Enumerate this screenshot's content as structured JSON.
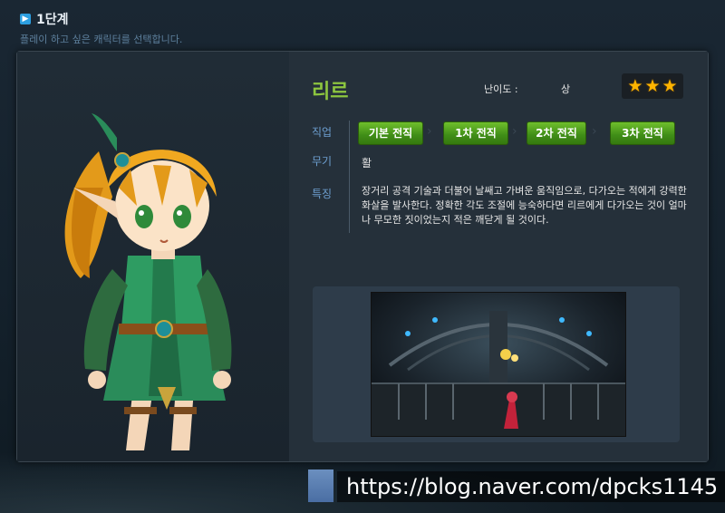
{
  "header": {
    "step_icon": "right-arrow-icon",
    "step_title": "1단계",
    "step_desc": "플레이 하고 싶은 캐릭터를 선택합니다."
  },
  "character": {
    "name": "리르",
    "difficulty_label": "난이도 :",
    "difficulty_value": "상",
    "difficulty_stars": 3,
    "job_label": "직업",
    "weapon_label": "무기",
    "feature_label": "특징",
    "jobs": [
      "기본 전직",
      "1차 전직",
      "2차 전직",
      "3차 전직"
    ],
    "weapon": "활",
    "description": "장거리 공격 기술과 더불어 날쌔고 가벼운 움직임으로, 다가오는 적에게 강력한 화살을 발사한다. 정확한 각도 조절에 능숙하다면 리르에게 다가오는 것이 얼마나 무모한 짓이었는지 적은 깨닫게 될 것이다."
  },
  "colors": {
    "name_green": "#8dc63f",
    "label_blue": "#6d9fd0",
    "button_green": "#4fa01e",
    "star_gold": "#ffb400"
  },
  "watermark": {
    "text": "https://blog.naver.com/dpcks1145"
  }
}
